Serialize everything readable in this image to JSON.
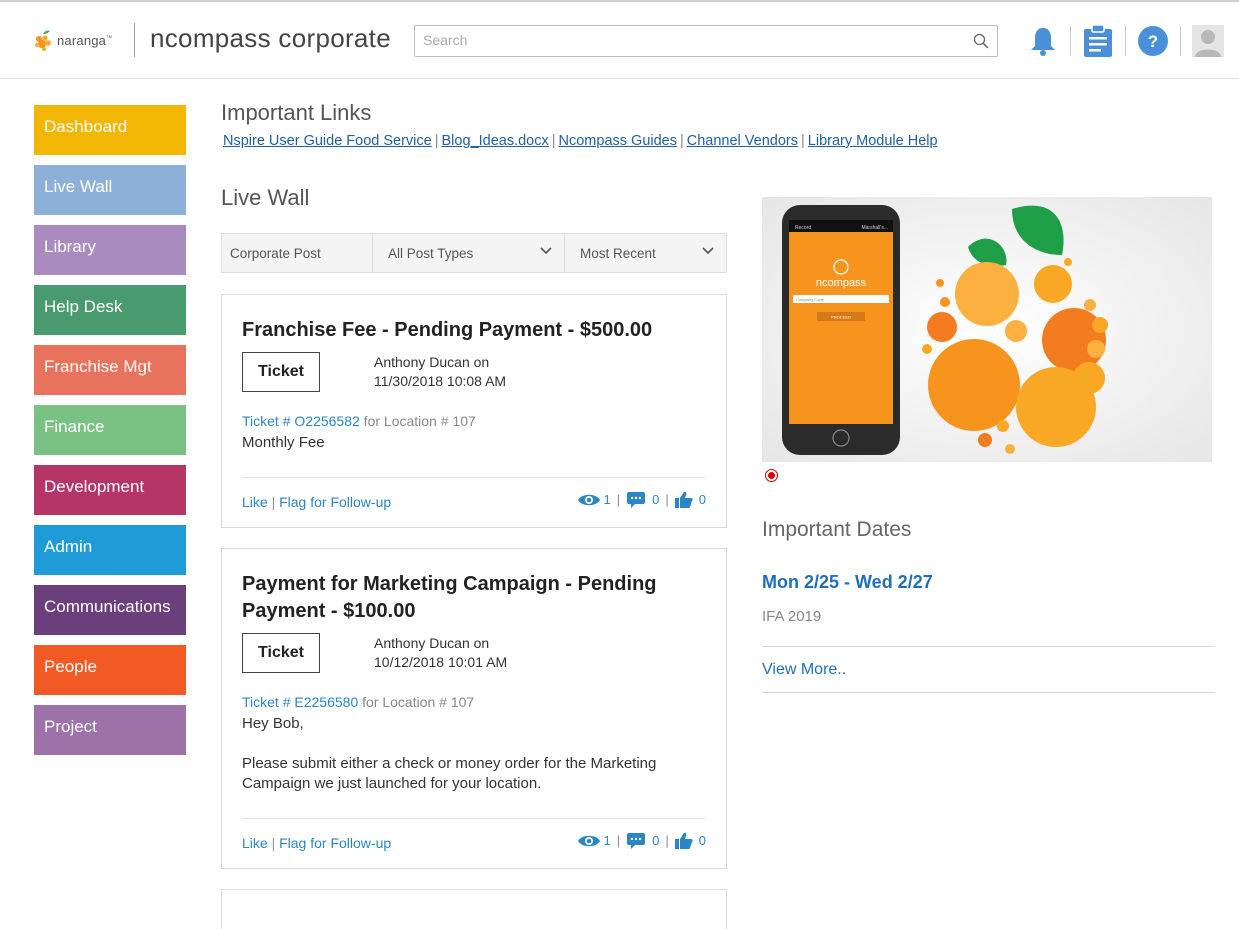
{
  "header": {
    "logo_text": "naranga",
    "logo_tm": "™",
    "brand_title": "ncompass corporate",
    "search_placeholder": "Search",
    "icons": [
      "bell-icon",
      "clipboard-icon",
      "help-icon",
      "avatar-icon"
    ],
    "help_glyph": "?"
  },
  "sidebar": {
    "items": [
      {
        "label": "Dashboard",
        "color": "#f2b705"
      },
      {
        "label": "Live Wall",
        "color": "#8db0d8"
      },
      {
        "label": "Library",
        "color": "#a98bbf"
      },
      {
        "label": "Help Desk",
        "color": "#4a9a6f"
      },
      {
        "label": "Franchise Mgt",
        "color": "#e8735c"
      },
      {
        "label": "Finance",
        "color": "#79c284"
      },
      {
        "label": "Development",
        "color": "#b53565"
      },
      {
        "label": "Admin",
        "color": "#1f9bd7"
      },
      {
        "label": "Communications",
        "color": "#6b3f7b"
      },
      {
        "label": "People",
        "color": "#f15a24"
      },
      {
        "label": "Project",
        "color": "#9c72a8"
      }
    ]
  },
  "important_links": {
    "title": "Important Links",
    "items": [
      "Nspire User Guide Food Service",
      "Blog_Ideas.docx",
      "Ncompass Guides",
      "Channel Vendors",
      "Library Module Help"
    ],
    "separator": "|"
  },
  "live_wall": {
    "title": "Live Wall",
    "filters": {
      "post_scope": "Corporate Post",
      "post_type": "All Post Types",
      "sort": "Most Recent"
    },
    "posts": [
      {
        "title": "Franchise Fee - Pending Payment - $500.00",
        "type_button": "Ticket",
        "author_line": "Anthony Ducan on",
        "timestamp": "11/30/2018 10:08 AM",
        "ticket_prefix": "Ticket # ",
        "ticket_number": "O2256582",
        "location": " for Location # 107",
        "body": [
          "Monthly Fee"
        ],
        "like": "Like",
        "flag": "Flag for Follow-up",
        "views": "1",
        "comments": "0",
        "likes": "0"
      },
      {
        "title": "Payment for Marketing Campaign - Pending Payment - $100.00",
        "type_button": "Ticket",
        "author_line": "Anthony Ducan on",
        "timestamp": "10/12/2018 10:01 AM",
        "ticket_prefix": "Ticket # ",
        "ticket_number": "E2256580",
        "location": " for Location # 107",
        "body": [
          "Hey Bob,",
          "Please submit either a check or money order for the Marketing Campaign we just launched for your location."
        ],
        "like": "Like",
        "flag": "Flag for Follow-up",
        "views": "1",
        "comments": "0",
        "likes": "0"
      }
    ]
  },
  "hero": {
    "phone_app_name": "ncompass",
    "phone_field_placeholder": "Company Code",
    "phone_button": "PROCEED",
    "phone_top_left": "Record",
    "phone_top_right": "Marshall's..."
  },
  "important_dates": {
    "title": "Important Dates",
    "range": "Mon 2/25 - Wed 2/27",
    "event": "IFA 2019",
    "view_more": "View More.."
  },
  "colors": {
    "link": "#1f5f9e",
    "accent_blue": "#2a86c6",
    "orange": "#f7941d"
  }
}
